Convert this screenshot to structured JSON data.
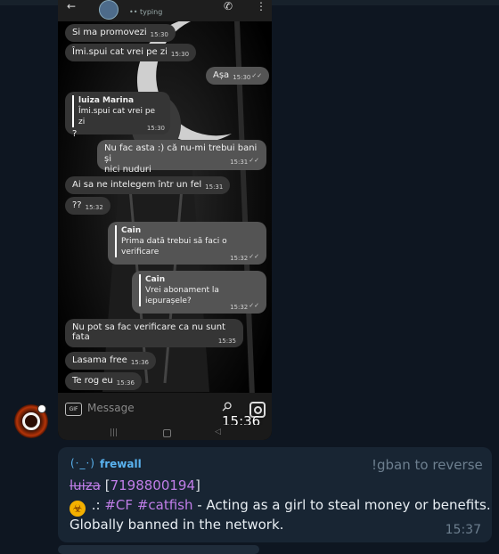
{
  "phone": {
    "header": {
      "status": "•• typing"
    },
    "messages": [
      {
        "text": "Si ma promovezi",
        "time": "15:30"
      },
      {
        "text": "Îmi.spui cat vrei pe zi",
        "time": "15:30"
      },
      {
        "text": "Așa",
        "time": "15:30",
        "ticks": "✓✓"
      },
      {
        "quote_name": "luiza Marina",
        "quote_text": "Îmi.spui cat vrei pe zi",
        "text": "?",
        "time": "15:30"
      },
      {
        "text_line1": "Nu fac asta :) că nu-mi trebui bani și",
        "text_line2": "nici nuduri",
        "time": "15:31",
        "ticks": "✓✓"
      },
      {
        "text": "Ai sa ne intelegem într un fel",
        "time": "15:31"
      },
      {
        "text": "??",
        "time": "15:32"
      },
      {
        "quote_name": "Cain",
        "quote_text": "Prima dată trebui să faci o verificare",
        "time": "15:32",
        "ticks": "✓✓"
      },
      {
        "quote_name": "Cain",
        "quote_text": "Vrei abonament la iepurașele?",
        "time": "15:32",
        "ticks": "✓✓"
      },
      {
        "text": "Nu pot sa fac verificare ca nu sunt fata",
        "time": "15:35"
      },
      {
        "text": "Lasama free",
        "time": "15:36"
      },
      {
        "text": "Te rog eu",
        "time": "15:36"
      }
    ],
    "input": {
      "gif_label": "GIF",
      "placeholder": "Message"
    },
    "clock": "15:36"
  },
  "bot_message": {
    "bot_icon": "(·_·)",
    "bot_name": "frewall",
    "gban_hint": "!gban to reverse",
    "user_name": "luiza",
    "user_id_open": "[",
    "user_id": "7198800194",
    "user_id_close": "]",
    "hazard_icon": "☣",
    "separator": " .: ",
    "tag1": "#CF",
    "tag2": "#catfish",
    "reason": " - Acting as a girl to steal money or benefits.",
    "reason_line2": "Globally banned in the network.",
    "time": "15:37"
  },
  "colors": {
    "background": "#0e1621",
    "bubble": "#182533",
    "accent": "#5ab3f0",
    "link": "#c07ee8"
  }
}
